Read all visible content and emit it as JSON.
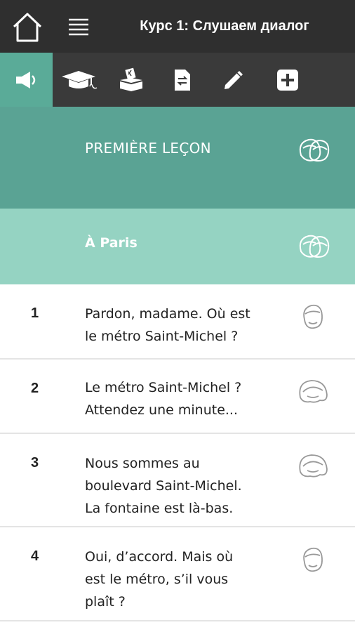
{
  "header": {
    "title": "Курс 1: Слушаем диалог",
    "home_icon": "home-icon",
    "menu_icon": "hamburger-menu-icon"
  },
  "toolbar": {
    "active_color": "#5aab98",
    "items": [
      {
        "icon": "speaker-icon",
        "active": true
      },
      {
        "icon": "graduation-cap-icon",
        "active": false
      },
      {
        "icon": "ballot-box-icon",
        "active": false
      },
      {
        "icon": "document-swap-icon",
        "active": false
      },
      {
        "icon": "pen-icon",
        "active": false
      },
      {
        "icon": "plus-box-icon",
        "active": false
      }
    ]
  },
  "lesson": {
    "title": "PREMIÈRE LEÇON",
    "color": "#5aa394"
  },
  "section": {
    "title": "À Paris",
    "color": "#95d3c2"
  },
  "dialogue": [
    {
      "number": "1",
      "lines": [
        "Pardon, madame. Où est",
        "le métro Saint-Michel ?"
      ],
      "speaker": "man-face-icon"
    },
    {
      "number": "2",
      "lines": [
        "Le métro Saint-Michel ?",
        "Attendez une minute..."
      ],
      "speaker": "woman-face-icon"
    },
    {
      "number": "3",
      "lines": [
        "Nous sommes au",
        "boulevard Saint-Michel.",
        "La fontaine est là-bas."
      ],
      "speaker": "woman-face-icon"
    },
    {
      "number": "4",
      "lines": [
        "Oui, d’accord. Mais où",
        "est le métro, s’il vous",
        "plaît ?"
      ],
      "speaker": "man-face-icon"
    }
  ]
}
